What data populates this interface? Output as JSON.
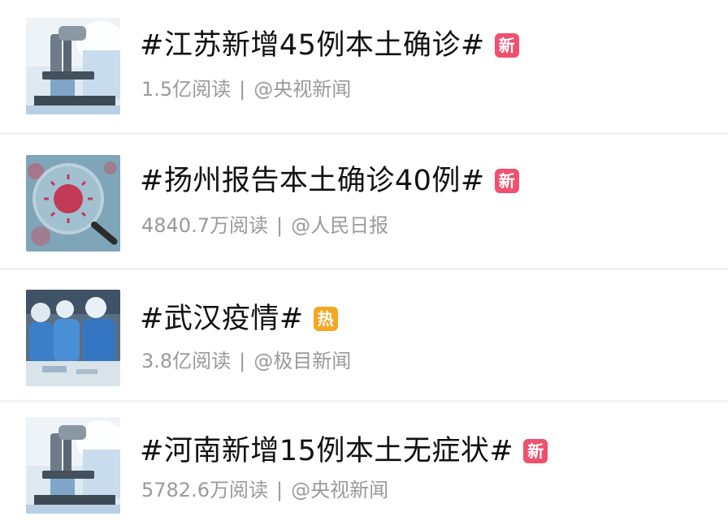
{
  "items": [
    {
      "title": "#江苏新增45例本土确诊#",
      "badge": "新",
      "badge_type": "new",
      "reads": "1.5亿阅读",
      "source": "@央视新闻",
      "thumbnail": "microscope-lab-image"
    },
    {
      "title": "#扬州报告本土确诊40例#",
      "badge": "新",
      "badge_type": "new",
      "reads": "4840.7万阅读",
      "source": "@人民日报",
      "thumbnail": "virus-magnifier-image"
    },
    {
      "title": "#武汉疫情#",
      "badge": "热",
      "badge_type": "hot",
      "reads": "3.8亿阅读",
      "source": "@极目新闻",
      "thumbnail": "medical-workers-image"
    },
    {
      "title": "#河南新增15例本土无症状#",
      "badge": "新",
      "badge_type": "new",
      "reads": "5782.6万阅读",
      "source": "@央视新闻",
      "thumbnail": "microscope-lab-image"
    }
  ],
  "separator": "|",
  "colors": {
    "badge_new": "#f0506e",
    "badge_hot": "#f5a623",
    "title": "#111111",
    "meta": "#9a9a9a"
  }
}
